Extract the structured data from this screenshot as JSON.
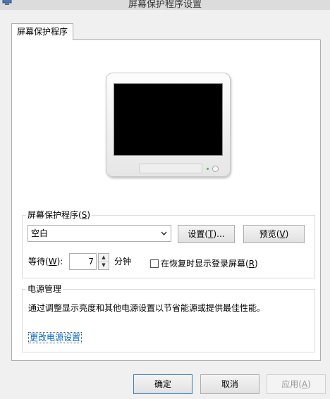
{
  "window": {
    "title": "屏幕保护程序设置"
  },
  "tabs": [
    {
      "label": "屏幕保护程序"
    }
  ],
  "screensaver": {
    "group_title_prefix": "屏幕保护程序(",
    "group_title_key": "S",
    "group_title_suffix": ")",
    "selected": "空白",
    "settings_prefix": "设置(",
    "settings_key": "T",
    "settings_suffix": ")...",
    "preview_prefix": "预览(",
    "preview_key": "V",
    "preview_suffix": ")",
    "wait_prefix": "等待(",
    "wait_key": "W",
    "wait_suffix": "):",
    "wait_value": "7",
    "wait_unit": "分钟",
    "resume_prefix": "在恢复时显示登录屏幕(",
    "resume_key": "R",
    "resume_suffix": ")",
    "resume_checked": false
  },
  "power": {
    "group_title": "电源管理",
    "description": "通过调整显示亮度和其他电源设置以节省能源或提供最佳性能。",
    "link": "更改电源设置"
  },
  "footer": {
    "ok": "确定",
    "cancel": "取消",
    "apply_prefix": "应用(",
    "apply_key": "A",
    "apply_suffix": ")"
  },
  "icons": {
    "title": "screensaver-settings-icon",
    "dropdown": "chevron-down-icon",
    "spin_up": "triangle-up-icon",
    "spin_down": "triangle-down-icon"
  }
}
